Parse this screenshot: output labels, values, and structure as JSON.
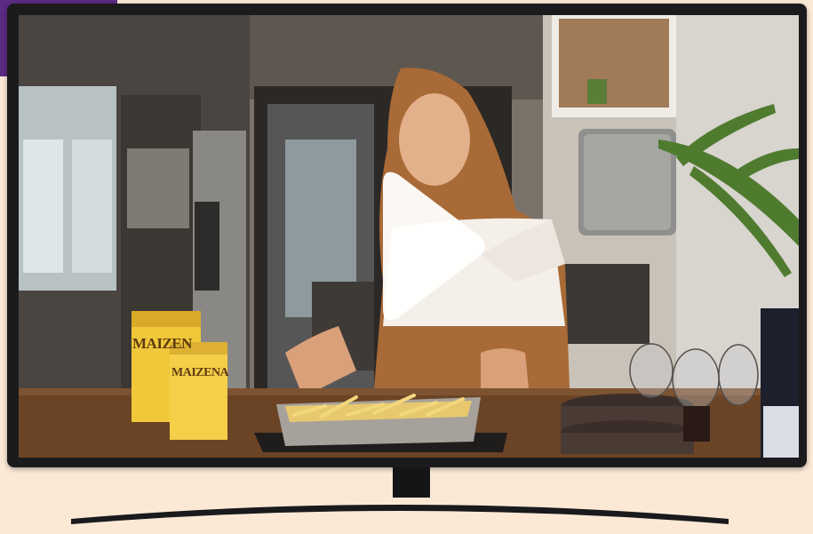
{
  "video": {
    "brand_box_text": "MAIZENA",
    "brand_box_text_back": "MAIZEN",
    "state": "paused"
  },
  "colors": {
    "page_background": "#fbe9d6",
    "accent_corner": "#5b2a82",
    "tv_frame": "#1b1b1d",
    "play_icon": "#ffffff"
  },
  "icons": {
    "play": "play-icon"
  }
}
